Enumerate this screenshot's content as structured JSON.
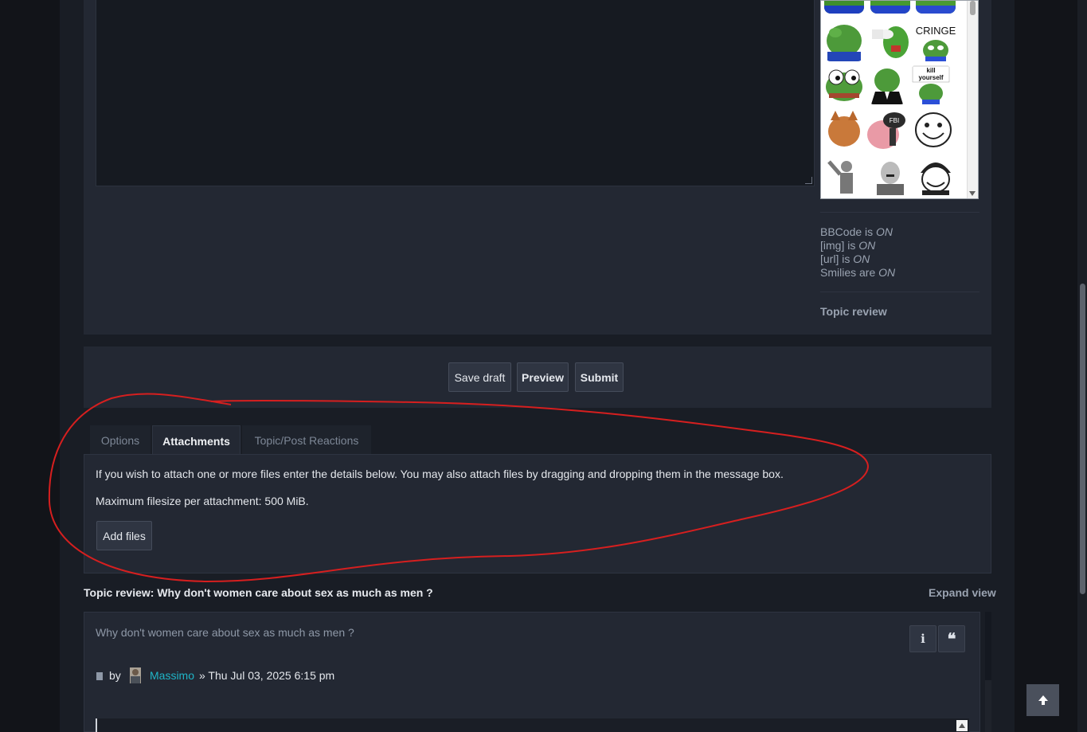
{
  "editor": {
    "smilies": [
      {
        "name": "pepe-smiley-1"
      },
      {
        "name": "pepe-smiley-2"
      },
      {
        "name": "pepe-smiley-3"
      },
      {
        "name": "pepe-smiley-4"
      },
      {
        "name": "pepe-smiley-5"
      },
      {
        "name": "pepe-cringe-smiley",
        "caption": "CRINGE"
      },
      {
        "name": "pepe-smiley-7"
      },
      {
        "name": "pepe-suit-smiley"
      },
      {
        "name": "pepe-kill-yourself-smiley",
        "caption": "kill yourself"
      },
      {
        "name": "cat-smiley"
      },
      {
        "name": "patrick-fbi-smiley",
        "caption": "FBI"
      },
      {
        "name": "troll-face-smiley"
      },
      {
        "name": "salute-figure-smiley"
      },
      {
        "name": "mustache-man-smiley"
      },
      {
        "name": "helmet-troll-smiley"
      }
    ],
    "status": {
      "bbcode_label": "BBCode is",
      "bbcode_value": "ON",
      "img_label": "[img] is",
      "img_value": "ON",
      "url_label": "[url] is",
      "url_value": "ON",
      "smilies_label": "Smilies are",
      "smilies_value": "ON"
    },
    "topic_review_link": "Topic review"
  },
  "actions": {
    "save_draft": "Save draft",
    "preview": "Preview",
    "submit": "Submit"
  },
  "tabs": {
    "options": "Options",
    "attachments": "Attachments",
    "reactions": "Topic/Post Reactions"
  },
  "attachments": {
    "info": "If you wish to attach one or more files enter the details below. You may also attach files by dragging and dropping them in the message box.",
    "max_size": "Maximum filesize per attachment: 500 MiB.",
    "add_files": "Add files"
  },
  "review": {
    "heading": "Topic review: Why don't women care about sex as much as men ?",
    "expand": "Expand view",
    "post_title": "Why don't women care about sex as much as men ?",
    "by": "by",
    "author": "Massimo",
    "date": "» Thu Jul 03, 2025 6:15 pm"
  },
  "colors": {
    "annotation_circle": "#d61f1f",
    "author_link": "#1fb5c7"
  }
}
